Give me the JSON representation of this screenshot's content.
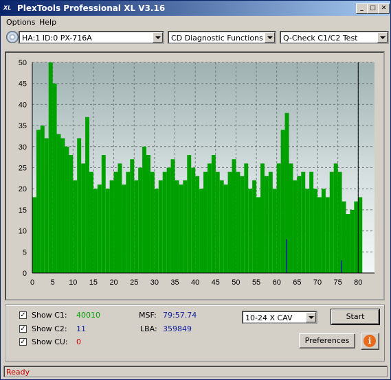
{
  "window": {
    "title": "PlexTools Professional XL V3.16",
    "app_icon_text": "XL",
    "controls": [
      "_",
      "□",
      "✕"
    ]
  },
  "menu": [
    "Options",
    "Help"
  ],
  "toolbar": {
    "drive": "HA:1 ID:0  PX-716A",
    "function": "CD Diagnostic Functions",
    "test": "Q-Check C1/C2 Test"
  },
  "chart_data": {
    "type": "bar",
    "x_ticks": [
      0,
      5,
      10,
      15,
      20,
      25,
      30,
      35,
      40,
      45,
      50,
      55,
      60,
      65,
      70,
      75,
      80
    ],
    "y_ticks": [
      0,
      5,
      10,
      15,
      20,
      25,
      30,
      35,
      40,
      45,
      50
    ],
    "xlim": [
      0,
      84
    ],
    "ylim": [
      0,
      50
    ],
    "data_end_x": 80,
    "grid": true,
    "series": [
      {
        "color": "#00a000",
        "x": [
          0,
          1,
          2,
          3,
          4,
          5,
          6,
          7,
          8,
          9,
          10,
          11,
          12,
          13,
          14,
          15,
          16,
          17,
          18,
          19,
          20,
          21,
          22,
          23,
          24,
          25,
          26,
          27,
          28,
          29,
          30,
          31,
          32,
          33,
          34,
          35,
          36,
          37,
          38,
          39,
          40,
          41,
          42,
          43,
          44,
          45,
          46,
          47,
          48,
          49,
          50,
          51,
          52,
          53,
          54,
          55,
          56,
          57,
          58,
          59,
          60,
          61,
          62,
          63,
          64,
          65,
          66,
          67,
          68,
          69,
          70,
          71,
          72,
          73,
          74,
          75,
          76,
          77,
          78,
          79,
          80
        ],
        "values": [
          18,
          34,
          35,
          32,
          50,
          45,
          33,
          32,
          30,
          28,
          22,
          32,
          26,
          37,
          24,
          20,
          21,
          28,
          20,
          22,
          24,
          26,
          21,
          24,
          27,
          22,
          25,
          30,
          28,
          24,
          20,
          22,
          24,
          25,
          27,
          22,
          21,
          22,
          28,
          25,
          23,
          20,
          24,
          26,
          28,
          24,
          22,
          21,
          24,
          27,
          24,
          23,
          26,
          20,
          22,
          18,
          26,
          23,
          24,
          20,
          26,
          34,
          38,
          26,
          22,
          23,
          24,
          20,
          24,
          20,
          18,
          20,
          18,
          24,
          26,
          24,
          17,
          14,
          15,
          17,
          18
        ]
      },
      {
        "color": "#1020a0",
        "x": [
          62.3,
          75.8
        ],
        "values": [
          8,
          3
        ]
      }
    ]
  },
  "options": {
    "c1": {
      "label": "Show C1:",
      "value": "40010",
      "checked": "✓"
    },
    "c2": {
      "label": "Show C2:",
      "value": "11",
      "checked": "✓"
    },
    "cu": {
      "label": "Show CU:",
      "value": "0",
      "checked": "✓"
    }
  },
  "readout": {
    "msf_label": "MSF:",
    "msf_value": "79:57.74",
    "lba_label": "LBA:",
    "lba_value": "359849"
  },
  "speed": "10-24 X CAV",
  "buttons": {
    "start": "Start",
    "preferences": "Preferences",
    "info": "i"
  },
  "status": "Ready",
  "colors": {
    "c1": "#00a000",
    "c2": "#1020a0",
    "cu": "#cc0000",
    "status": "#cc0000"
  }
}
